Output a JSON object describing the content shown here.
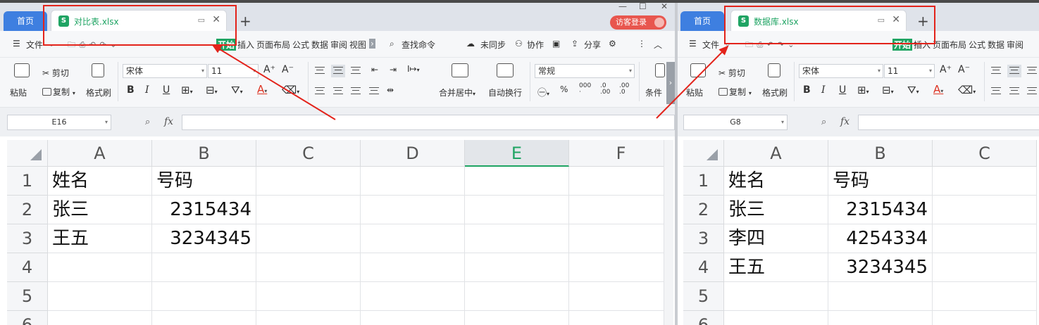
{
  "left": {
    "home_tab": "首页",
    "file_tab": "对比表.xlsx",
    "visitor_login": "访客登录",
    "menu": {
      "file": "文件",
      "start": "开始",
      "insert": "插入",
      "page_layout": "页面布局",
      "formula": "公式",
      "data": "数据",
      "review": "审阅",
      "view": "视图",
      "search": "查找命令",
      "unsynced": "未同步",
      "collab": "协作",
      "share": "分享"
    },
    "ribbon": {
      "paste": "粘贴",
      "cut": "剪切",
      "copy": "复制",
      "format_painter": "格式刷",
      "font_name": "宋体",
      "font_size": "11",
      "merge_center": "合并居中",
      "wrap_text": "自动换行",
      "number_format": "常规",
      "cond_format": "条件"
    },
    "name_box": "E16",
    "columns": [
      "A",
      "B",
      "C",
      "D",
      "E",
      "F"
    ],
    "active_column": "E",
    "row_numbers": [
      "1",
      "2",
      "3",
      "4",
      "5",
      "6"
    ],
    "rows": [
      [
        "姓名",
        "号码"
      ],
      [
        "张三",
        "2315434"
      ],
      [
        "王五",
        "3234345"
      ]
    ]
  },
  "right": {
    "home_tab": "首页",
    "file_tab": "数据库.xlsx",
    "menu": {
      "file": "文件",
      "start": "开始",
      "insert": "插入",
      "page_layout": "页面布局",
      "formula": "公式",
      "data": "数据",
      "review": "审阅"
    },
    "ribbon": {
      "paste": "粘贴",
      "cut": "剪切",
      "copy": "复制",
      "format_painter": "格式刷",
      "font_name": "宋体",
      "font_size": "11"
    },
    "name_box": "G8",
    "columns": [
      "A",
      "B",
      "C"
    ],
    "row_numbers": [
      "1",
      "2",
      "3",
      "4",
      "5",
      "6"
    ],
    "rows": [
      [
        "姓名",
        "号码"
      ],
      [
        "张三",
        "2315434"
      ],
      [
        "李四",
        "4254334"
      ],
      [
        "王五",
        "3234345"
      ]
    ]
  },
  "colors": {
    "accent_green": "#1fa463",
    "home_blue": "#3e7fe0",
    "annotation_red": "#e3231b",
    "visitor_red": "#e8564e"
  }
}
